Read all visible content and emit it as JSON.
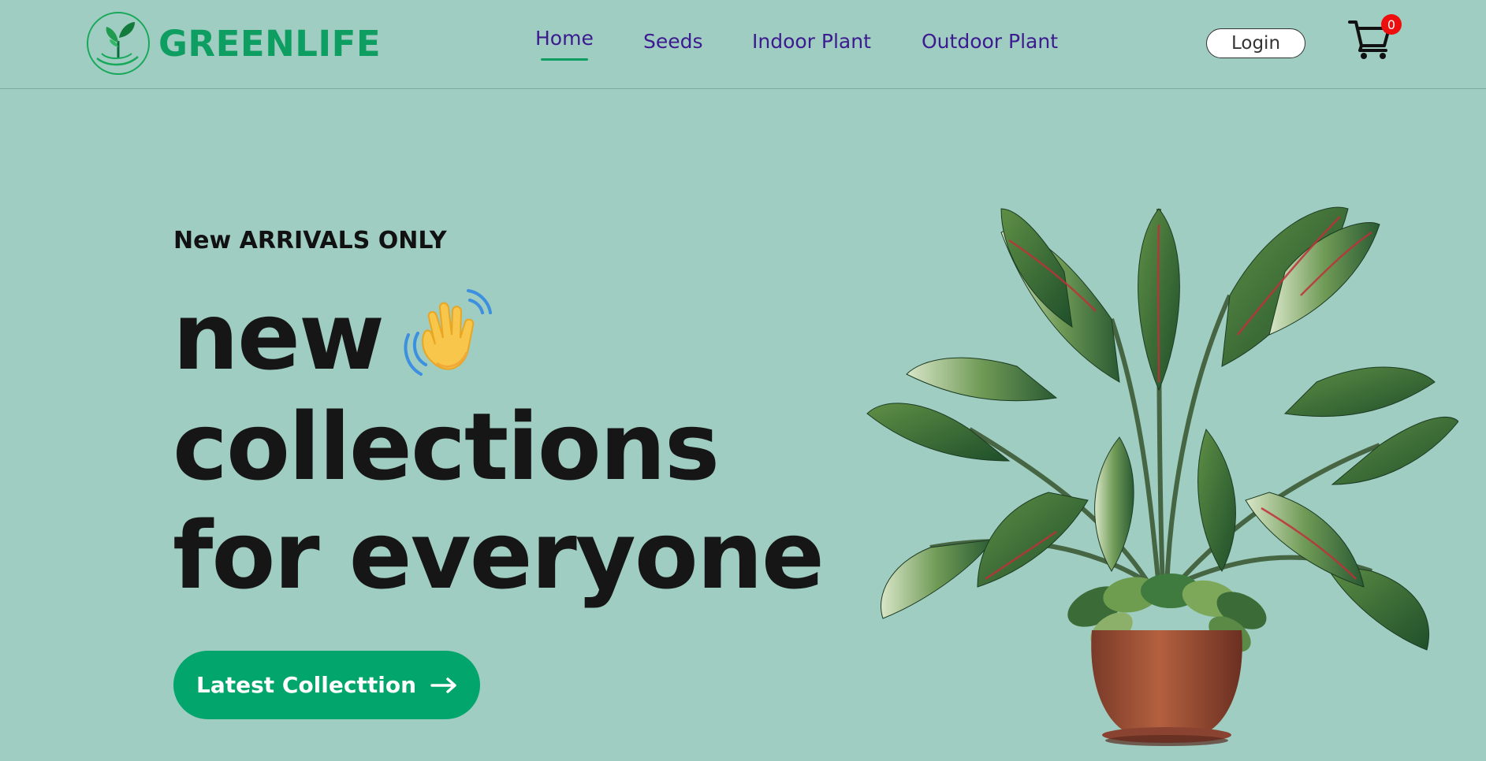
{
  "brand": {
    "name": "GREENLIFE",
    "color": "#0e9e61"
  },
  "nav": {
    "items": [
      {
        "label": "Home",
        "active": true
      },
      {
        "label": "Seeds",
        "active": false
      },
      {
        "label": "Indoor Plant",
        "active": false
      },
      {
        "label": "Outdoor Plant",
        "active": false
      }
    ],
    "link_color": "#3c1a8f"
  },
  "header": {
    "login_label": "Login"
  },
  "cart": {
    "count": "0",
    "icon": "cart-icon",
    "badge_color": "#ef0e0e"
  },
  "hero": {
    "eyebrow": "New ARRIVALS ONLY",
    "title_lines": [
      "new",
      "collections",
      "for everyone"
    ],
    "wave_icon": "waving-hand-icon",
    "cta_label": "Latest Collecttion",
    "cta_icon": "arrow-right-icon",
    "cta_color": "#02a56c"
  },
  "page": {
    "background": "#9fcdc1"
  }
}
